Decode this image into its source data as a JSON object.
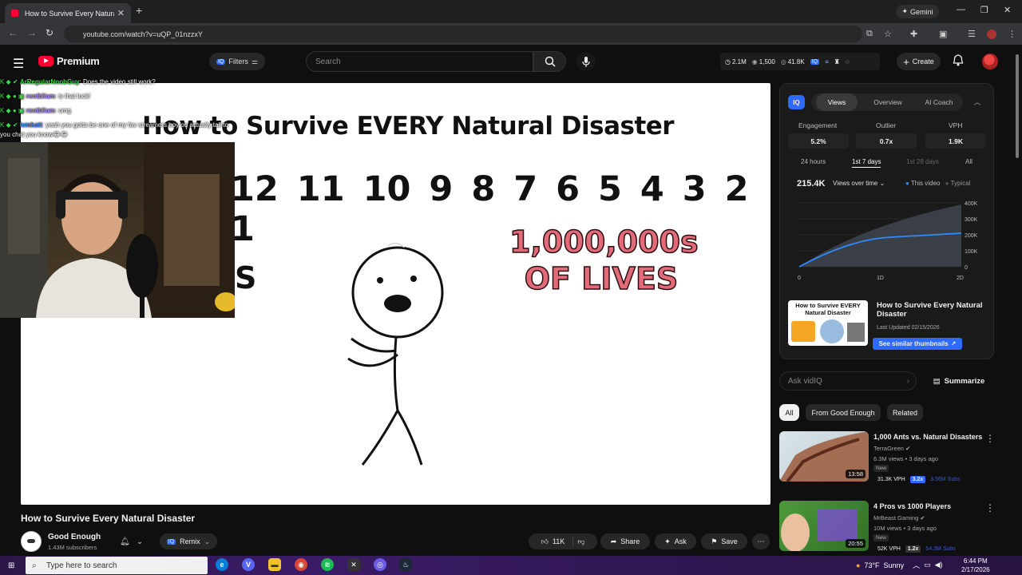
{
  "browser": {
    "tab_title": "How to Survive Every Natural D",
    "url": "youtube.com/watch?v=uQP_01nzzxY",
    "gemini_label": "Gemini"
  },
  "header": {
    "brand": "Premium",
    "filters_label": "Filters",
    "search_placeholder": "Search",
    "stats": {
      "views": "2.1M",
      "videos": "1,500",
      "watchers": "41.8K"
    },
    "create_label": "Create"
  },
  "chat": [
    {
      "user": "ArRegularNoobGuy",
      "user_color": "#3cd94a",
      "text": ": Does the video still work?"
    },
    {
      "user": "rentbliam",
      "user_color": "#b38cff",
      "text": ": is that luck!"
    },
    {
      "user": "rentbliam",
      "user_color": "#b38cff",
      "text": ": omg"
    },
    {
      "user": "lvmkatt",
      "user_color": "#3a8cff",
      "text": ": yeah you gotta be one of my fav streamers boy ou actually tall to"
    },
    {
      "user": "",
      "user_color": "#fff",
      "text": "you chat you know😂😂"
    }
  ],
  "video": {
    "frame_title": "How to Survive EVERY Natural Disaster",
    "countdown": "12 11 10 9 8 7 6 5 4 3 2 1",
    "lives_line1": "1,000,000s",
    "lives_line2": "OF LIVES",
    "partial_text": "S",
    "title": "How to Survive Every Natural Disaster",
    "channel": "Good Enough",
    "subscribers": "1.43M subscribers",
    "remix_label": "Remix",
    "likes": "11K",
    "share_label": "Share",
    "ask_label": "Ask",
    "save_label": "Save"
  },
  "vidiq": {
    "logo": "IQ",
    "tabs": [
      "Views",
      "Overview",
      "AI Coach"
    ],
    "metrics": [
      {
        "label": "Engagement",
        "value": "5.2%"
      },
      {
        "label": "Outlier",
        "value": "0.7x"
      },
      {
        "label": "VPH",
        "value": "1.9K"
      }
    ],
    "ranges": [
      "24 hours",
      "1st 7 days",
      "1st 28 days",
      "All"
    ],
    "total_views": "215.4K",
    "selector_label": "Views over time",
    "legend_this": "This video",
    "legend_typical": "Typical",
    "chart_y_ticks": [
      "400K",
      "300K",
      "200K",
      "100K",
      "0"
    ],
    "chart_x_ticks": [
      "0",
      "1D",
      "2D"
    ],
    "thumb_title": "How to Survive Every Natural Disaster",
    "thumb_date": "Last Updated 02/15/2026",
    "similar_label": "See similar thumbnails",
    "ask_placeholder": "Ask vidIQ",
    "summarize_label": "Summarize",
    "thumb_text": "How to Survive EVERY Natural Disaster"
  },
  "chips": [
    "All",
    "From Good Enough",
    "Related"
  ],
  "recommendations": [
    {
      "title": "1,000 Ants vs. Natural Disasters",
      "channel": "TerraGreen",
      "meta": "6.3M views • 3 days ago",
      "new": "New",
      "duration": "13:58",
      "vph": "31.3K VPH",
      "multiplier": "3.2x",
      "subs": "3.56M Subs",
      "thumb_color": "#c9d6dc"
    },
    {
      "title": "4 Pros vs 1000 Players",
      "channel": "MrBeast Gaming",
      "meta": "10M views • 3 days ago",
      "new": "New",
      "duration": "20:55",
      "vph": "52K VPH",
      "multiplier": "1.2x",
      "subs": "54.3M Subs",
      "thumb_color": "#3a8a2f"
    }
  ],
  "taskbar": {
    "search_placeholder": "Type here to search",
    "temperature": "73°F",
    "weather": "Sunny",
    "time": "6:44 PM",
    "date": "2/17/2026"
  },
  "colors": {
    "accent": "#2d6bff",
    "youtube_red": "#ff0033",
    "lives_pink": "#e26b7a"
  }
}
